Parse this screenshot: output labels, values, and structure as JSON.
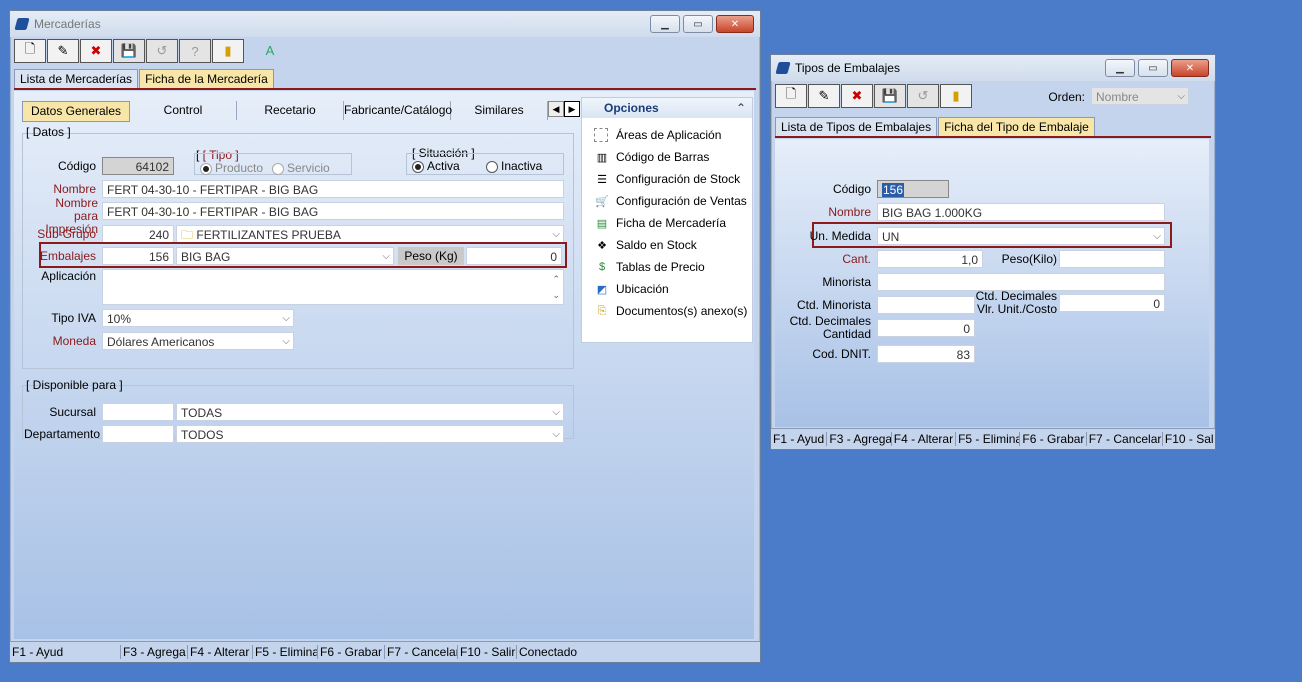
{
  "win1": {
    "title": "Mercaderías",
    "tabs": [
      "Lista de Mercaderías",
      "Ficha de la Mercadería"
    ],
    "subtabs": [
      "Datos Generales",
      "Control",
      "Recetario",
      "Fabricante/Catálogo",
      "Similares"
    ],
    "datos_title": "[ Datos ]",
    "codigo_label": "Código",
    "codigo_value": "64102",
    "tipo_title": "[ Tipo ]",
    "tipo_opt1": "Producto",
    "tipo_opt2": "Servicio",
    "situacion_title": "[ Situación ]",
    "sit_opt1": "Activa",
    "sit_opt2": "Inactiva",
    "nombre_label": "Nombre",
    "nombre_value": "FERT 04-30-10 - FERTIPAR - BIG BAG",
    "nombre_imp_label": "Nombre para Impresión",
    "nombre_imp_value": "FERT 04-30-10 - FERTIPAR - BIG BAG",
    "subgrupo_label": "Sub-Grupo",
    "subgrupo_code": "240",
    "subgrupo_value": "FERTILIZANTES PRUEBA",
    "embalajes_label": "Embalajes",
    "embalajes_code": "156",
    "embalajes_value": "BIG BAG",
    "peso_label": "Peso (Kg)",
    "peso_value": "0",
    "aplicacion_label": "Aplicación",
    "tipo_iva_label": "Tipo IVA",
    "tipo_iva_value": "10%",
    "moneda_label": "Moneda",
    "moneda_value": "Dólares Americanos",
    "disp_title": "[ Disponible para ]",
    "sucursal_label": "Sucursal",
    "sucursal_value": "TODAS",
    "depto_label": "Departamento",
    "depto_value": "TODOS",
    "opciones_title": "Opciones",
    "opciones": [
      "Áreas de Aplicación",
      "Código de Barras",
      "Configuración de Stock",
      "Configuración de Ventas",
      "Ficha de Mercadería",
      "Saldo en Stock",
      "Tablas de Precio",
      "Ubicación",
      "Documentos(s) anexo(s)"
    ],
    "status": [
      "F1 - Ayud",
      "F3 - Agrega",
      "F4 - Alterar",
      "F5 - Elimina",
      "F6 - Grabar",
      "F7 - Cancelar",
      "F10 - Salir",
      "Conectado"
    ]
  },
  "win2": {
    "title": "Tipos de Embalajes",
    "orden_label": "Orden:",
    "orden_value": "Nombre",
    "tabs": [
      "Lista de Tipos de Embalajes",
      "Ficha del Tipo de Embalaje"
    ],
    "codigo_label": "Código",
    "codigo_value": "156",
    "nombre_label": "Nombre",
    "nombre_value": "BIG BAG 1.000KG",
    "unmedida_label": "Un. Medida",
    "unmedida_value": "UN",
    "cant_label": "Cant.",
    "cant_value": "1,0",
    "peso_label": "Peso(Kilo)",
    "peso_value": "",
    "minorista_label": "Minorista",
    "ctd_min_label": "Ctd. Minorista",
    "ctd_dec_vlr_label": "Ctd. Decimales Vlr. Unit./Costo",
    "ctd_dec_vlr_value": "0",
    "ctd_dec_cant_label": "Ctd. Decimales Cantidad",
    "ctd_dec_cant_value": "0",
    "dnit_label": "Cod. DNIT.",
    "dnit_value": "83",
    "status": [
      "F1 - Ayud",
      "F3 - Agrega",
      "F4 - Alterar",
      "F5 - Elimina",
      "F6 - Grabar",
      "F7 - Cancelar",
      "F10 - Sal"
    ]
  },
  "colors": {
    "desktop": "#4a7cc9",
    "active_tab": "#f7e6a8",
    "highlight": "#8b1a1a"
  }
}
